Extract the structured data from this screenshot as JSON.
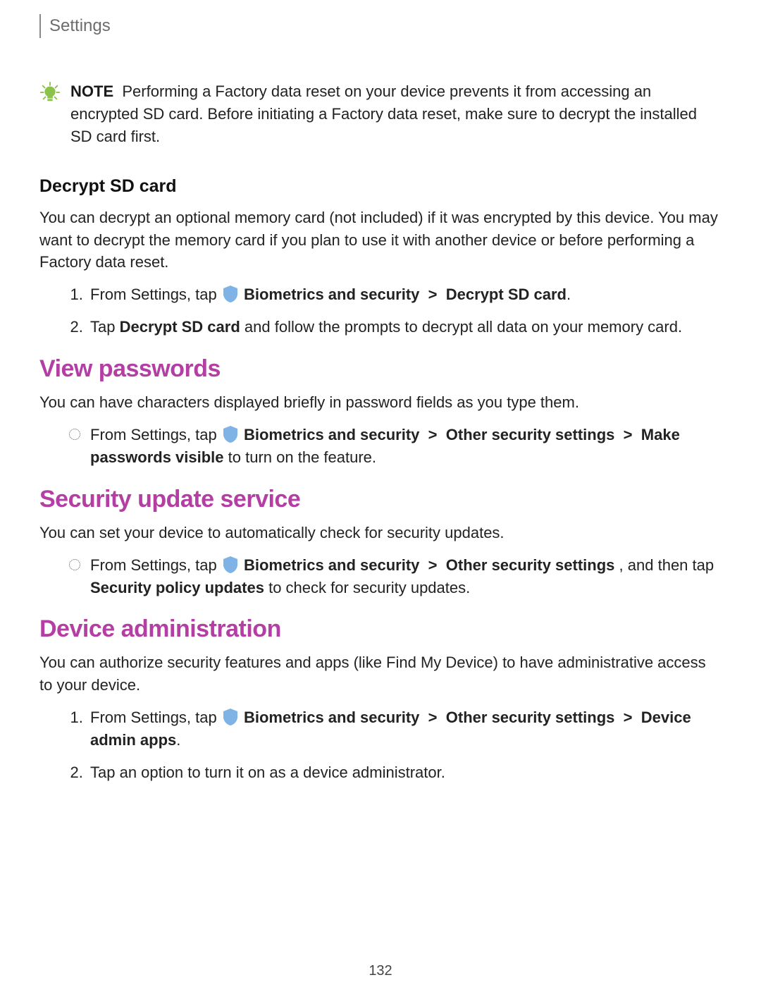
{
  "header": {
    "title": "Settings"
  },
  "note": {
    "label": "NOTE",
    "text": "Performing a Factory data reset on your device prevents it from accessing an encrypted SD card. Before initiating a Factory data reset, make sure to decrypt the installed SD card first."
  },
  "sections": {
    "decrypt": {
      "heading": "Decrypt SD card",
      "intro": "You can decrypt an optional memory card (not included) if it was encrypted by this device. You may want to decrypt the memory card if you plan to use it with another device or before performing a Factory data reset.",
      "step1_prefix": "From Settings, tap ",
      "step1_path1": "Biometrics and security",
      "step1_path2": "Decrypt SD card",
      "step2_prefix": "Tap ",
      "step2_bold": "Decrypt SD card",
      "step2_suffix": " and follow the prompts to decrypt all data on your memory card."
    },
    "view_passwords": {
      "heading": "View passwords",
      "intro": "You can have characters displayed briefly in password fields as you type them.",
      "step1_prefix": "From Settings, tap ",
      "path1": "Biometrics and security",
      "path2": "Other security settings",
      "path3": "Make passwords visible",
      "suffix": " to turn on the feature."
    },
    "security_update": {
      "heading": "Security update service",
      "intro": "You can set your device to automatically check for security updates.",
      "step1_prefix": "From Settings, tap ",
      "path1": "Biometrics and security",
      "path2": "Other security settings",
      "mid": ", and then tap ",
      "path3": "Security policy updates",
      "suffix": " to check for security updates."
    },
    "device_admin": {
      "heading": "Device administration",
      "intro": "You can authorize security features and apps (like Find My Device) to have administrative access to your device.",
      "step1_prefix": "From Settings, tap ",
      "path1": "Biometrics and security",
      "path2": "Other security settings",
      "path3": "Device admin apps",
      "step2": "Tap an option to turn it on as a device administrator."
    }
  },
  "glyphs": {
    "chevron": ">",
    "period": "."
  },
  "page_number": "132"
}
